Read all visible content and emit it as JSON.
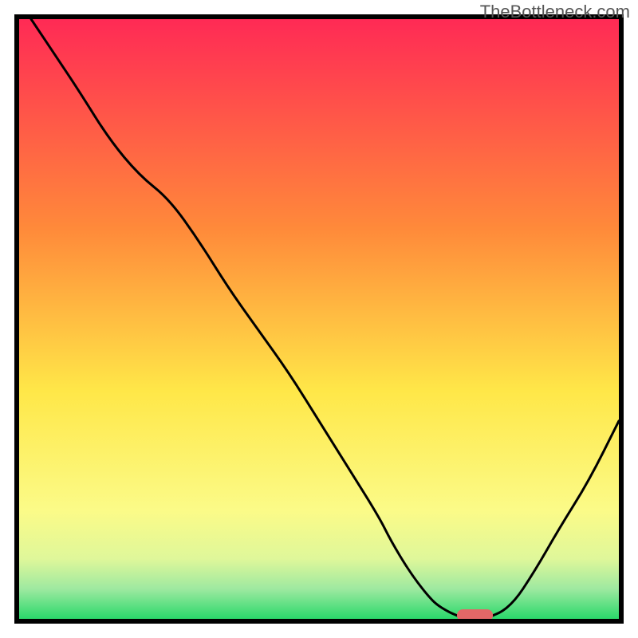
{
  "watermark": "TheBottleneck.com",
  "chart_data": {
    "type": "line",
    "title": "",
    "xlabel": "",
    "ylabel": "",
    "xlim": [
      0,
      100
    ],
    "ylim": [
      0,
      100
    ],
    "series": [
      {
        "name": "bottleneck_curve",
        "x": [
          2,
          6,
          10,
          15,
          20,
          25,
          30,
          35,
          40,
          45,
          50,
          55,
          60,
          62,
          65,
          68,
          70,
          74,
          78,
          82,
          86,
          90,
          95,
          100
        ],
        "y": [
          100,
          94,
          88,
          80,
          74,
          70,
          63,
          55,
          48,
          41,
          33,
          25,
          17,
          13,
          8,
          4,
          2,
          0,
          0,
          2,
          8,
          15,
          23,
          33
        ]
      }
    ],
    "marker": {
      "x": 76,
      "y": 0,
      "width": 6,
      "height": 2,
      "color": "#e36767"
    },
    "gradient": {
      "top_color": "#ff2a55",
      "mid1_color": "#ff8a3a",
      "mid2_color": "#ffe748",
      "ylw_color": "#fbfb88",
      "grn_color": "#2ad86b"
    },
    "frame": {
      "color": "#000000",
      "thickness_px": 6,
      "inner_margin_pct": 3
    },
    "curve_style": {
      "stroke": "#000000",
      "stroke_width": 3
    }
  }
}
